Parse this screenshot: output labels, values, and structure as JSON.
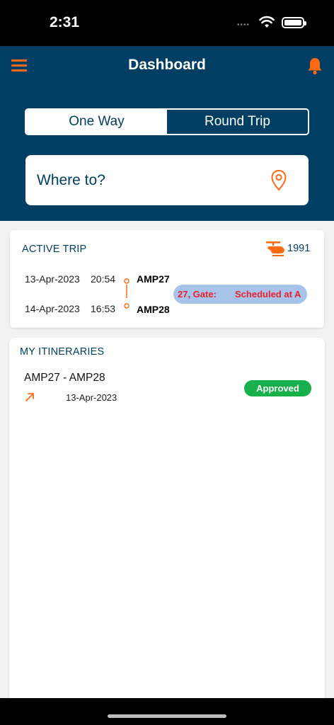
{
  "status_bar": {
    "time": "2:31",
    "signal": "••••"
  },
  "header": {
    "title": "Dashboard"
  },
  "trip_toggle": {
    "one_way": "One Way",
    "round_trip": "Round Trip",
    "selected": "Round Trip"
  },
  "search": {
    "placeholder": "Where to?"
  },
  "active_trip": {
    "title": "ACTIVE TRIP",
    "flight_number": "1991",
    "departure": {
      "date": "13-Apr-2023",
      "time": "20:54",
      "code": "AMP27"
    },
    "arrival": {
      "date": "14-Apr-2023",
      "time": "16:53",
      "code": "AMP28"
    },
    "info_gate": "27, Gate:",
    "info_status": "Scheduled at A"
  },
  "itineraries": {
    "title": "MY ITINERARIES",
    "items": [
      {
        "route": "AMP27 - AMP28",
        "date": "13-Apr-2023",
        "status": "Approved"
      }
    ]
  },
  "colors": {
    "primary": "#003f63",
    "accent": "#ff6a13",
    "approved": "#18b04b",
    "alert": "#e8202a",
    "pill": "#a8c3ea"
  },
  "icons": [
    "menu-icon",
    "bell-icon",
    "map-pin-icon",
    "helicopter-icon",
    "arrow-up-right-icon",
    "wifi-icon",
    "battery-icon"
  ]
}
